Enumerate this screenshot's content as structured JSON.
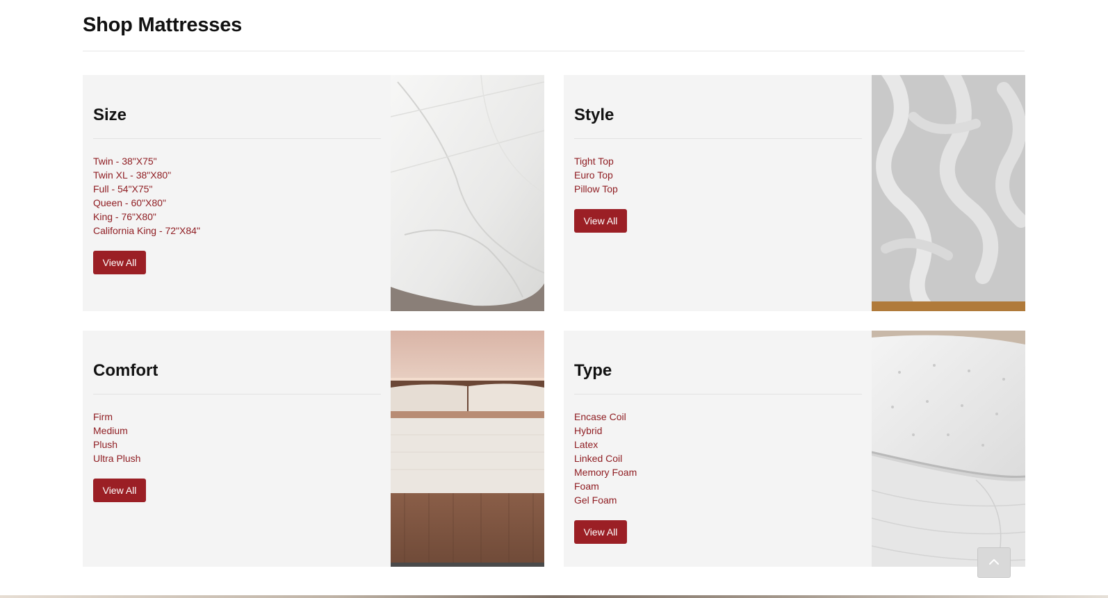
{
  "page": {
    "title": "Shop Mattresses"
  },
  "cards": [
    {
      "title": "Size",
      "links": [
        "Twin - 38\"X75\"",
        "Twin XL - 38\"X80\"",
        "Full - 54\"X75\"",
        "Queen - 60\"X80\"",
        "King - 76\"X80\"",
        "California King - 72\"X84\""
      ],
      "button": "View All",
      "image": "quilted-mattress-corner-photo"
    },
    {
      "title": "Style",
      "links": [
        "Tight Top",
        "Euro Top",
        "Pillow Top"
      ],
      "button": "View All",
      "image": "mattress-fabric-texture-photo"
    },
    {
      "title": "Comfort",
      "links": [
        "Firm",
        "Medium",
        "Plush",
        "Ultra Plush"
      ],
      "button": "View All",
      "image": "bed-with-pillows-photo"
    },
    {
      "title": "Type",
      "links": [
        "Encase Coil",
        "Hybrid",
        "Latex",
        "Linked Coil",
        "Memory Foam",
        "Foam",
        "Gel Foam"
      ],
      "button": "View All",
      "image": "tufted-mattress-photo"
    }
  ],
  "scroll_top": {
    "icon": "chevron-up-icon"
  },
  "colors": {
    "accent": "#9b1f25",
    "link": "#8f1d22",
    "card_bg": "#f4f4f4"
  }
}
